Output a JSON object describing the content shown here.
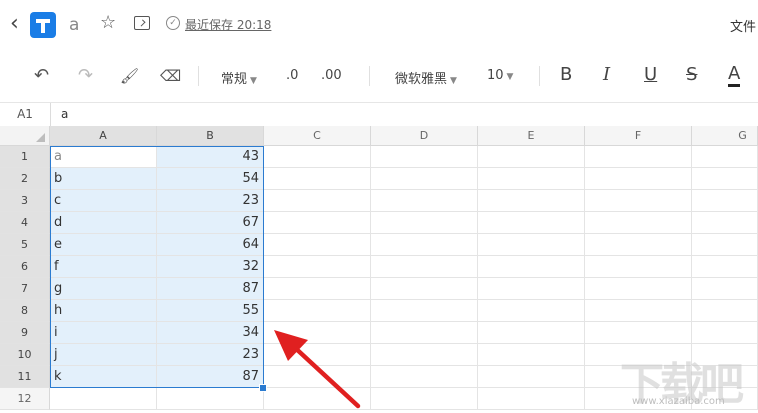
{
  "header": {
    "doc_title": "a",
    "saved_text": "最近保存 20:18",
    "file_menu": "文件"
  },
  "toolbar": {
    "format_label": "常规",
    "decimal_decrease": ".0",
    "decimal_increase": ".00",
    "font_name": "微软雅黑",
    "font_size": "10",
    "bold": "B",
    "italic": "I",
    "underline": "U",
    "strike": "S",
    "font_color": "A"
  },
  "formula_bar": {
    "cell_ref": "A1",
    "value": "a"
  },
  "sheet": {
    "columns": [
      "A",
      "B",
      "C",
      "D",
      "E",
      "F",
      "G"
    ],
    "rows": [
      {
        "num": "1",
        "a": "a",
        "b": "43"
      },
      {
        "num": "2",
        "a": "b",
        "b": "54"
      },
      {
        "num": "3",
        "a": "c",
        "b": "23"
      },
      {
        "num": "4",
        "a": "d",
        "b": "67"
      },
      {
        "num": "5",
        "a": "e",
        "b": "64"
      },
      {
        "num": "6",
        "a": "f",
        "b": "32"
      },
      {
        "num": "7",
        "a": "g",
        "b": "87"
      },
      {
        "num": "8",
        "a": "h",
        "b": "55"
      },
      {
        "num": "9",
        "a": "i",
        "b": "34"
      },
      {
        "num": "10",
        "a": "j",
        "b": "23"
      },
      {
        "num": "11",
        "a": "k",
        "b": "87"
      },
      {
        "num": "12",
        "a": "",
        "b": ""
      }
    ]
  },
  "annotation": {
    "arrow_color": "#e02020"
  },
  "colors": {
    "selection": "#2b7bd0",
    "selection_fill": "#e3f0fb"
  }
}
